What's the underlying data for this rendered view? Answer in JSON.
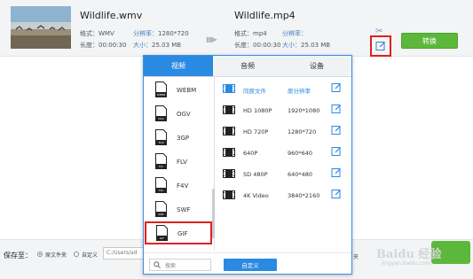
{
  "source": {
    "filename": "Wildlife.wmv",
    "format_label": "格式：",
    "format_value": "WMV",
    "resolution_label": "分辨率：",
    "resolution_value": "1280*720",
    "duration_label": "长度：",
    "duration_value": "00:00:30",
    "size_label": "大小：",
    "size_value": "25.03 MB"
  },
  "output": {
    "filename": "Wildlife.mp4",
    "format_label": "格式：",
    "format_value": "mp4",
    "resolution_label": "分辨率：",
    "resolution_value": "",
    "duration_label": "长度：",
    "duration_value": "00:00:30",
    "size_label": "大小：",
    "size_value": "25.03 MB"
  },
  "actions": {
    "convert_label": "转换",
    "cut_icon": "scissors-icon",
    "edit_icon": "edit-icon"
  },
  "popup": {
    "tabs": [
      {
        "label": "视频",
        "active": true
      },
      {
        "label": "音频",
        "active": false
      },
      {
        "label": "设备",
        "active": false
      }
    ],
    "formats": [
      {
        "label": "WEBM",
        "tag": "WEBM"
      },
      {
        "label": "OGV",
        "tag": "OGV"
      },
      {
        "label": "3GP",
        "tag": "3GP"
      },
      {
        "label": "FLV",
        "tag": "FLV"
      },
      {
        "label": "F4V",
        "tag": "F4V"
      },
      {
        "label": "SWF",
        "tag": "SWF"
      },
      {
        "label": "GIF",
        "tag": "GIF",
        "selected": true
      }
    ],
    "presets": [
      {
        "name": "同原文件",
        "resolution": "原分辨率",
        "highlight": true
      },
      {
        "name": "HD 1080P",
        "resolution": "1920*1080"
      },
      {
        "name": "HD 720P",
        "resolution": "1280*720"
      },
      {
        "name": "640P",
        "resolution": "960*640"
      },
      {
        "name": "SD 480P",
        "resolution": "640*480"
      },
      {
        "name": "4K Video",
        "resolution": "3840*2160"
      }
    ],
    "search_placeholder": "搜索",
    "custom_label": "自定义"
  },
  "bottom": {
    "save_to_label": "保存至：",
    "radio_source_label": "原文件夹",
    "radio_custom_label": "自定义",
    "path_value": "C:/Users/ad",
    "partial_text": "夹",
    "watermark": "Baidu 经验",
    "watermark_sub": "jingyan.baidu.com"
  },
  "colors": {
    "accent": "#2a8ae2",
    "green": "#5cb83a",
    "highlight_red": "#e02020"
  }
}
